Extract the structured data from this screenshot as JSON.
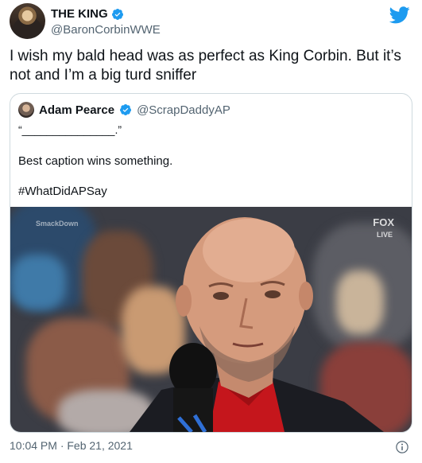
{
  "author": {
    "display_name": "THE KING",
    "handle": "@BaronCorbinWWE"
  },
  "tweet": {
    "text": "I wish my bald head was as perfect as King Corbin.  But it’s not and I’m a big turd sniffer"
  },
  "quoted_tweet": {
    "display_name": "Adam Pearce",
    "handle": "@ScrapDaddyAP",
    "line1": "“_______________.”",
    "line2": "Best caption wins something.",
    "line3": "#WhatDidAPSay",
    "image_watermark_left": "SmackDown",
    "image_watermark_right": "FOX",
    "image_live_label": "LIVE"
  },
  "timestamp": "10:04 PM · Feb 21, 2021",
  "colors": {
    "verified": "#1d9bf0",
    "twitter_bird": "#1d9bf0",
    "secondary_text": "#536471",
    "border": "#cfd9de"
  },
  "icons": [
    "twitter-bird-icon",
    "verified-badge-icon",
    "info-icon"
  ]
}
